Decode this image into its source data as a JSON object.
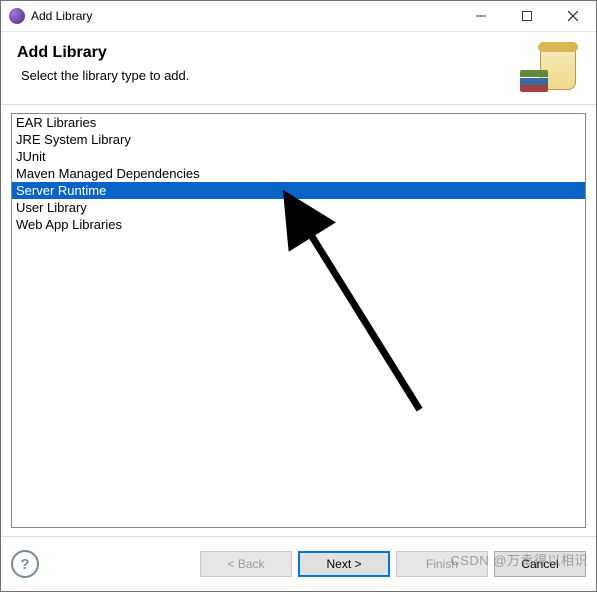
{
  "window": {
    "title": "Add Library"
  },
  "wizard": {
    "heading": "Add Library",
    "subheading": "Select the library type to add."
  },
  "library_list": {
    "items": [
      "EAR Libraries",
      "JRE System Library",
      "JUnit",
      "Maven Managed Dependencies",
      "Server Runtime",
      "User Library",
      "Web App Libraries"
    ],
    "selected_index": 4
  },
  "buttons": {
    "back": "< Back",
    "next": "Next >",
    "finish": "Finish",
    "cancel": "Cancel",
    "help": "?"
  },
  "watermark": "CSDN @万幸得以相识"
}
